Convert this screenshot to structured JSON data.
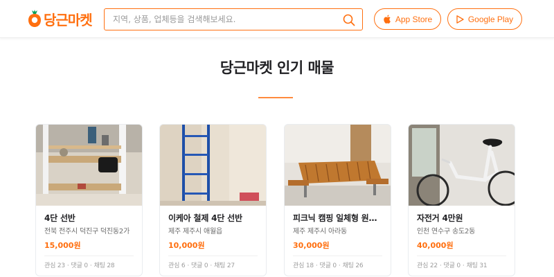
{
  "header": {
    "logo_text": "당근마켓",
    "search_placeholder": "지역, 상품, 업체등을 검색해보세요.",
    "app_store_label": "App Store",
    "google_play_label": "Google Play"
  },
  "main": {
    "title": "당근마켓 인기 매물"
  },
  "colors": {
    "accent": "#ff6f0f",
    "rule": "#ff8a3d"
  },
  "products": [
    {
      "title": "4단 선반",
      "region": "전북 전주시 덕진구 덕진동2가",
      "price": "15,000원",
      "likes_label": "관심 23",
      "comments_label": "댓글 0",
      "chats_label": "채팅 28"
    },
    {
      "title": "이케아 철제 4단 선반",
      "region": "제주 제주시 애월읍",
      "price": "10,000원",
      "likes_label": "관심 6",
      "comments_label": "댓글 0",
      "chats_label": "채팅 27"
    },
    {
      "title": "피크닉 캠핑 일체형 원목…",
      "region": "제주 제주시 아라동",
      "price": "30,000원",
      "likes_label": "관심 18",
      "comments_label": "댓글 0",
      "chats_label": "채팅 26"
    },
    {
      "title": "자전거 4만원",
      "region": "인천 연수구 송도2동",
      "price": "40,000원",
      "likes_label": "관심 22",
      "comments_label": "댓글 0",
      "chats_label": "채팅 31"
    }
  ]
}
